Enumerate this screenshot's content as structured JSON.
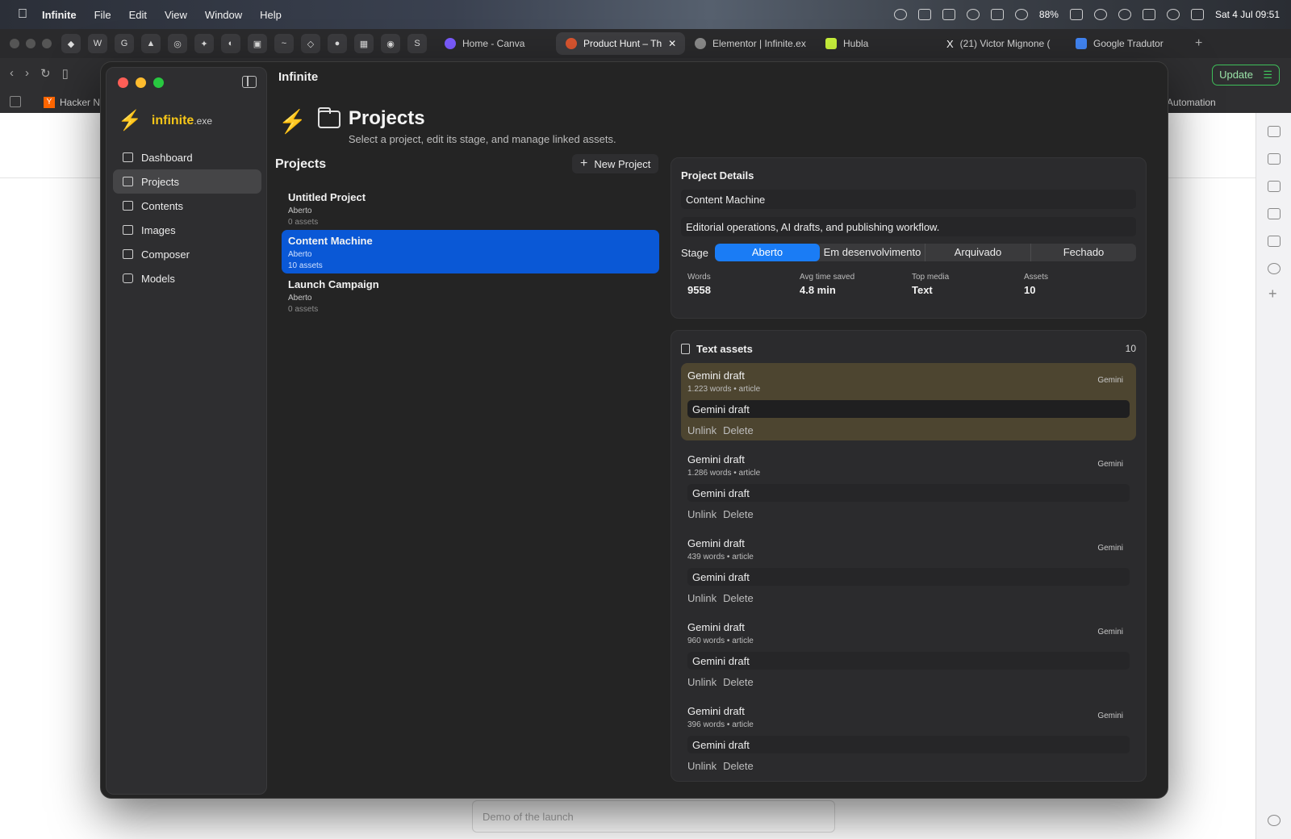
{
  "menubar": {
    "app": "Infinite",
    "items": [
      "File",
      "Edit",
      "View",
      "Window",
      "Help"
    ],
    "battery": "88%",
    "clock": "Sat 4 Jul  09:51"
  },
  "browser": {
    "tabs": [
      {
        "title": "Home - Canva",
        "fav_color": "#7b5cff"
      },
      {
        "title": "Product Hunt – Th",
        "fav_color": "#da552f",
        "active": true
      },
      {
        "title": "Elementor | Infinite.ex",
        "fav_color": "#8a8a8a"
      },
      {
        "title": "Hubla",
        "fav_color": "#c9f23c"
      },
      {
        "title": "(21) Victor Mignone (",
        "fav_color": "#222222"
      },
      {
        "title": "Google Tradutor",
        "fav_color": "#4285f4"
      }
    ],
    "update_label": "Update",
    "bookmark_left": "Hacker N",
    "bookmark_right": "Automation",
    "page_input_placeholder": "Demo of the launch"
  },
  "app": {
    "window_title": "Infinite",
    "brand": {
      "name": "infinite",
      "ext": ".exe"
    },
    "nav": [
      {
        "label": "Dashboard",
        "icon": "grid-icon"
      },
      {
        "label": "Projects",
        "icon": "folder-icon",
        "active": true
      },
      {
        "label": "Contents",
        "icon": "document-icon"
      },
      {
        "label": "Images",
        "icon": "image-icon"
      },
      {
        "label": "Composer",
        "icon": "compose-icon"
      },
      {
        "label": "Models",
        "icon": "cpu-icon"
      }
    ],
    "header": {
      "title": "Projects",
      "subtitle": "Select a project, edit its stage, and manage linked assets."
    },
    "projects": {
      "title": "Projects",
      "new_label": "New Project",
      "items": [
        {
          "name": "Untitled Project",
          "stage": "Aberto",
          "assets": "0 assets"
        },
        {
          "name": "Content Machine",
          "stage": "Aberto",
          "assets": "10 assets",
          "selected": true
        },
        {
          "name": "Launch Campaign",
          "stage": "Aberto",
          "assets": "0 assets"
        }
      ]
    },
    "details": {
      "title": "Project Details",
      "name_value": "Content Machine",
      "description_value": "Editorial operations, AI drafts, and publishing workflow.",
      "stage_label": "Stage",
      "stages": [
        "Aberto",
        "Em desenvolvimento",
        "Arquivado",
        "Fechado"
      ],
      "active_stage": "Aberto",
      "stats": [
        {
          "label": "Words",
          "value": "9558"
        },
        {
          "label": "Avg time saved",
          "value": "4.8 min"
        },
        {
          "label": "Top media",
          "value": "Text"
        },
        {
          "label": "Assets",
          "value": "10"
        }
      ]
    },
    "assets": {
      "title": "Text assets",
      "count": "10",
      "unlink_label": "Unlink",
      "delete_label": "Delete",
      "items": [
        {
          "name": "Gemini draft",
          "meta": "1.223 words • article",
          "model": "Gemini",
          "value": "Gemini draft",
          "highlight": true
        },
        {
          "name": "Gemini draft",
          "meta": "1.286 words • article",
          "model": "Gemini",
          "value": "Gemini draft"
        },
        {
          "name": "Gemini draft",
          "meta": "439 words • article",
          "model": "Gemini",
          "value": "Gemini draft"
        },
        {
          "name": "Gemini draft",
          "meta": "960 words • article",
          "model": "Gemini",
          "value": "Gemini draft"
        },
        {
          "name": "Gemini draft",
          "meta": "396 words • article",
          "model": "Gemini",
          "value": "Gemini draft"
        }
      ]
    },
    "colors": {
      "accent": "#1a7cf5",
      "selected_row": "#0a58d6",
      "brand_yellow": "#f5c518",
      "highlight_asset": "#4d4530"
    }
  }
}
